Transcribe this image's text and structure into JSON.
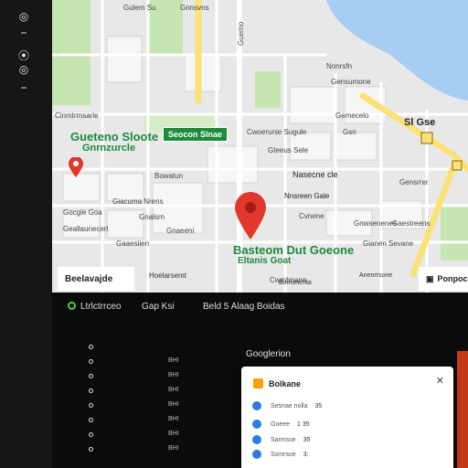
{
  "rail": {
    "items": [
      {
        "icon": "location-icon",
        "glyph": "◎"
      },
      {
        "icon": "menu-icon",
        "glyph": "–"
      },
      {
        "icon": "pin-icon",
        "glyph": "⦿"
      },
      {
        "icon": "layers-icon",
        "glyph": "◎"
      },
      {
        "icon": "more-icon",
        "glyph": "–"
      }
    ]
  },
  "map": {
    "labels": [
      {
        "text": "Gulem Su",
        "angle": 0
      },
      {
        "text": "Gnnsvns",
        "angle": 0
      },
      {
        "text": "Guemo",
        "angle": -90
      },
      {
        "text": "Cinmtrmsarle",
        "angle": 0
      },
      {
        "text": "Bowatun",
        "angle": 0
      },
      {
        "text": "Giacuma Nrens",
        "angle": 0
      },
      {
        "text": "Gocgie Goa",
        "angle": 0
      },
      {
        "text": "Geallaunecerl",
        "angle": 0
      },
      {
        "text": "Gnalsrn",
        "angle": 0
      },
      {
        "text": "Gnaeeni",
        "angle": 0
      },
      {
        "text": "Nonrsfn",
        "angle": 0
      },
      {
        "text": "Gensumone",
        "angle": 0
      },
      {
        "text": "Cwoerunie Sugule",
        "angle": 0
      },
      {
        "text": "Gteeus Sele",
        "angle": 0
      },
      {
        "text": "Gemecelo",
        "angle": 0
      },
      {
        "text": "Cvnene",
        "angle": 0
      },
      {
        "text": "Sl Gse",
        "angle": 0
      },
      {
        "text": "Gnwsenenes",
        "angle": 0
      },
      {
        "text": "Gianen Sevane",
        "angle": 0
      },
      {
        "text": "Gaestreens",
        "angle": 0
      },
      {
        "text": "Gaaesiien",
        "angle": 0
      },
      {
        "text": "Cwmbnane",
        "angle": 0
      },
      {
        "text": "Gsn",
        "angle": 0
      },
      {
        "text": "Gensrrer",
        "angle": 0
      }
    ],
    "place_title": "Gueteno Sloote",
    "place_subtitle": "Gnrnzurcle",
    "green_tag": "Seocon Slnae",
    "center_title": "Basteom Dut Goeone",
    "center_subtitle": "Eltanis Goat",
    "right_label": "Nasecne cle",
    "right_label2": "Nnsreen Gale",
    "shield_text": "G",
    "shield_text2": "G",
    "bottom_chips": [
      {
        "label": "Beelavajde"
      },
      {
        "label": "Ponpoce"
      }
    ],
    "bottom_texts": [
      "Hoelarsemt",
      "Bomonenta",
      "Anenrrsone"
    ]
  },
  "panel": {
    "head_left": "Ltrlctrrceo",
    "head_mid": "Gap Ksi",
    "head_right": "Beld 5 Alaag Boidas",
    "google_label": "Googlerion",
    "rows": [
      {
        "value": ""
      },
      {
        "value": "BHI"
      },
      {
        "value": "BHI"
      },
      {
        "value": "BHI"
      },
      {
        "value": "BHI"
      },
      {
        "value": "BHI"
      },
      {
        "value": "BHI"
      },
      {
        "value": "BHI"
      }
    ]
  },
  "popup": {
    "title": "Bolkane",
    "close_glyph": "✕",
    "rows": [
      {
        "text": "Sesnae nolla",
        "num": "35"
      },
      {
        "text": "Goeee",
        "num": "1 35"
      },
      {
        "text": "Sarmsse",
        "num": "35"
      },
      {
        "text": "Ssmrsoe",
        "num": "3:"
      }
    ]
  },
  "colors": {
    "water": "#a7cdf2",
    "park": "#c6e6b1",
    "road_major": "#fbe17a",
    "accent_green": "#1d8b3a",
    "pin_red": "#e2372b"
  }
}
